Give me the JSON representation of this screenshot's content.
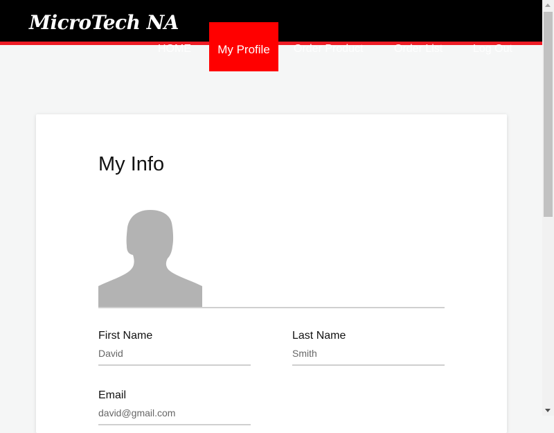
{
  "brand": {
    "name": "MicroTech NA"
  },
  "nav": {
    "items": [
      {
        "label": "HOME"
      },
      {
        "label": "My Profile"
      },
      {
        "label": "Order Product"
      },
      {
        "label": "Order List"
      },
      {
        "label": "Log Out"
      }
    ],
    "active_index": 1
  },
  "profile": {
    "title": "My Info",
    "fields": {
      "first_name": {
        "label": "First Name",
        "value": "David"
      },
      "last_name": {
        "label": "Last Name",
        "value": "Smith"
      },
      "email": {
        "label": "Email",
        "value": "david@gmail.com"
      }
    }
  },
  "colors": {
    "header_bg": "#000000",
    "accent_red": "#ff0000",
    "header_underline": "#ee1c25",
    "page_bg": "#f5f6f6"
  },
  "icons": {
    "avatar": "user-silhouette-icon"
  }
}
